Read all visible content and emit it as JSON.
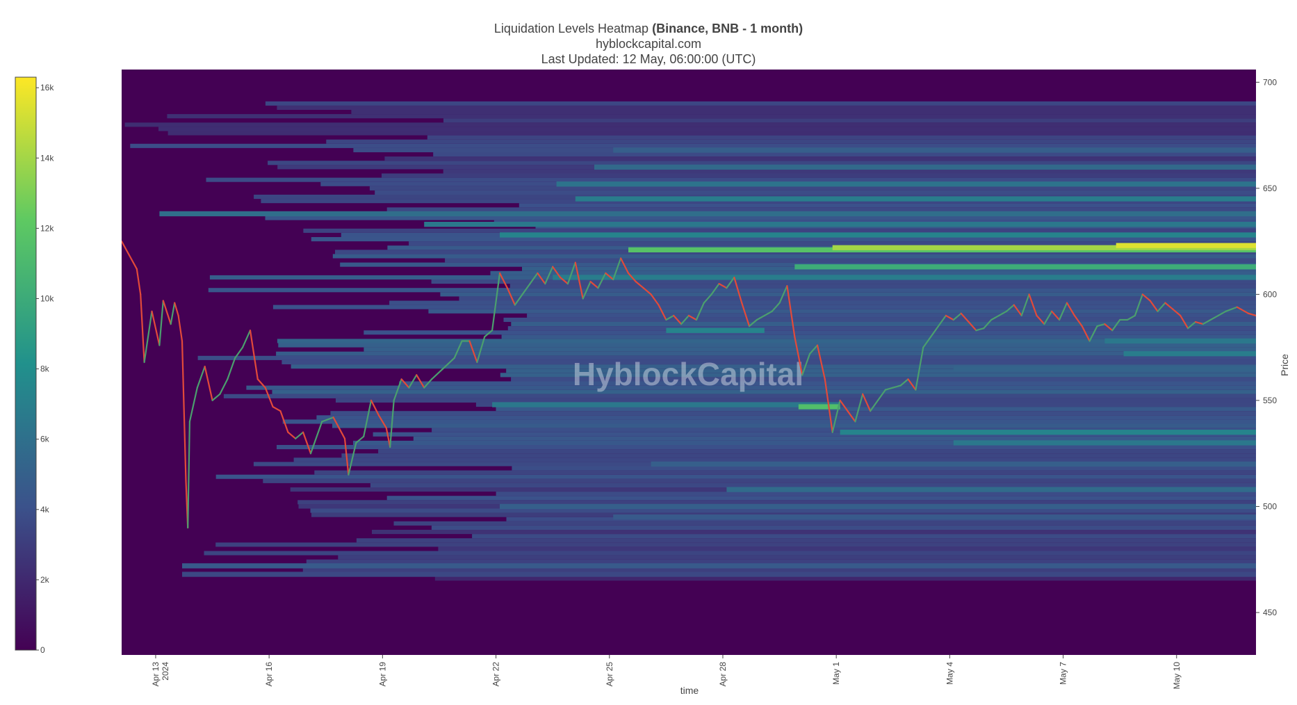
{
  "title": {
    "main": "Liquidation Levels Heatmap",
    "bold": "(Binance, BNB - 1 month)",
    "site": "hyblockcapital.com",
    "updated": "Last Updated: 12 May, 06:00:00 (UTC)"
  },
  "watermark": "HyblockCapital",
  "colors": {
    "background": "#440154",
    "candle_up": "#4b9f6e",
    "candle_down": "#e24a3a",
    "colorscale": [
      "#440154",
      "#3b528b",
      "#21918c",
      "#5ec962",
      "#fde725"
    ]
  },
  "chart_data": {
    "type": "heatmap",
    "xlabel": "time",
    "ylabel": "Price",
    "ylim": [
      430,
      706
    ],
    "x_ticks": [
      {
        "day": 0.9,
        "label": "Apr 13",
        "label2": "2024"
      },
      {
        "day": 3.9,
        "label": "Apr 16"
      },
      {
        "day": 6.9,
        "label": "Apr 19"
      },
      {
        "day": 9.9,
        "label": "Apr 22"
      },
      {
        "day": 12.9,
        "label": "Apr 25"
      },
      {
        "day": 15.9,
        "label": "Apr 28"
      },
      {
        "day": 18.9,
        "label": "May 1"
      },
      {
        "day": 21.9,
        "label": "May 4"
      },
      {
        "day": 24.9,
        "label": "May 7"
      },
      {
        "day": 27.9,
        "label": "May 10"
      }
    ],
    "x_domain_days": [
      0,
      30
    ],
    "y_ticks": [
      450,
      500,
      550,
      600,
      650,
      700
    ],
    "colorbar": {
      "ticks": [
        0,
        2000,
        4000,
        6000,
        8000,
        10000,
        12000,
        14000,
        16000
      ],
      "labels": [
        "0",
        "2k",
        "4k",
        "6k",
        "8k",
        "10k",
        "12k",
        "14k",
        "16k"
      ],
      "max": 16300
    },
    "price_path": [
      [
        0.0,
        625
      ],
      [
        0.4,
        612
      ],
      [
        0.5,
        600
      ],
      [
        0.6,
        568
      ],
      [
        0.8,
        592
      ],
      [
        1.0,
        576
      ],
      [
        1.1,
        597
      ],
      [
        1.3,
        586
      ],
      [
        1.4,
        596
      ],
      [
        1.5,
        590
      ],
      [
        1.6,
        578
      ],
      [
        1.7,
        512
      ],
      [
        1.75,
        490
      ],
      [
        1.8,
        540
      ],
      [
        2.0,
        556
      ],
      [
        2.2,
        566
      ],
      [
        2.4,
        550
      ],
      [
        2.6,
        553
      ],
      [
        2.8,
        560
      ],
      [
        3.0,
        570
      ],
      [
        3.2,
        575
      ],
      [
        3.4,
        583
      ],
      [
        3.6,
        560
      ],
      [
        3.8,
        556
      ],
      [
        4.0,
        547
      ],
      [
        4.2,
        545
      ],
      [
        4.4,
        535
      ],
      [
        4.6,
        532
      ],
      [
        4.8,
        535
      ],
      [
        5.0,
        525
      ],
      [
        5.3,
        540
      ],
      [
        5.6,
        542
      ],
      [
        5.9,
        532
      ],
      [
        6.0,
        515
      ],
      [
        6.2,
        530
      ],
      [
        6.4,
        533
      ],
      [
        6.6,
        550
      ],
      [
        6.8,
        543
      ],
      [
        7.0,
        537
      ],
      [
        7.1,
        528
      ],
      [
        7.2,
        550
      ],
      [
        7.4,
        560
      ],
      [
        7.6,
        556
      ],
      [
        7.8,
        562
      ],
      [
        8.0,
        556
      ],
      [
        8.2,
        560
      ],
      [
        8.5,
        565
      ],
      [
        8.8,
        570
      ],
      [
        9.0,
        578
      ],
      [
        9.2,
        578
      ],
      [
        9.4,
        568
      ],
      [
        9.6,
        580
      ],
      [
        9.8,
        583
      ],
      [
        10.0,
        610
      ],
      [
        10.2,
        603
      ],
      [
        10.4,
        595
      ],
      [
        10.6,
        600
      ],
      [
        10.8,
        605
      ],
      [
        11.0,
        610
      ],
      [
        11.2,
        605
      ],
      [
        11.4,
        613
      ],
      [
        11.6,
        608
      ],
      [
        11.8,
        605
      ],
      [
        12.0,
        615
      ],
      [
        12.2,
        598
      ],
      [
        12.4,
        606
      ],
      [
        12.6,
        603
      ],
      [
        12.8,
        610
      ],
      [
        13.0,
        607
      ],
      [
        13.2,
        617
      ],
      [
        13.4,
        610
      ],
      [
        13.6,
        606
      ],
      [
        13.8,
        603
      ],
      [
        14.0,
        600
      ],
      [
        14.2,
        595
      ],
      [
        14.4,
        588
      ],
      [
        14.6,
        590
      ],
      [
        14.8,
        586
      ],
      [
        15.0,
        590
      ],
      [
        15.2,
        588
      ],
      [
        15.4,
        596
      ],
      [
        15.6,
        600
      ],
      [
        15.8,
        605
      ],
      [
        16.0,
        603
      ],
      [
        16.2,
        608
      ],
      [
        16.4,
        596
      ],
      [
        16.6,
        585
      ],
      [
        16.8,
        588
      ],
      [
        17.0,
        590
      ],
      [
        17.2,
        592
      ],
      [
        17.4,
        596
      ],
      [
        17.6,
        604
      ],
      [
        17.8,
        580
      ],
      [
        18.0,
        562
      ],
      [
        18.2,
        572
      ],
      [
        18.4,
        576
      ],
      [
        18.6,
        560
      ],
      [
        18.8,
        535
      ],
      [
        19.0,
        550
      ],
      [
        19.2,
        545
      ],
      [
        19.4,
        540
      ],
      [
        19.6,
        553
      ],
      [
        19.8,
        545
      ],
      [
        20.0,
        550
      ],
      [
        20.2,
        555
      ],
      [
        20.4,
        556
      ],
      [
        20.6,
        557
      ],
      [
        20.8,
        560
      ],
      [
        21.0,
        555
      ],
      [
        21.2,
        575
      ],
      [
        21.4,
        580
      ],
      [
        21.6,
        585
      ],
      [
        21.8,
        590
      ],
      [
        22.0,
        588
      ],
      [
        22.2,
        591
      ],
      [
        22.4,
        587
      ],
      [
        22.6,
        583
      ],
      [
        22.8,
        584
      ],
      [
        23.0,
        588
      ],
      [
        23.2,
        590
      ],
      [
        23.4,
        592
      ],
      [
        23.6,
        595
      ],
      [
        23.8,
        590
      ],
      [
        24.0,
        600
      ],
      [
        24.2,
        590
      ],
      [
        24.4,
        586
      ],
      [
        24.6,
        592
      ],
      [
        24.8,
        588
      ],
      [
        25.0,
        596
      ],
      [
        25.2,
        590
      ],
      [
        25.4,
        585
      ],
      [
        25.6,
        578
      ],
      [
        25.8,
        585
      ],
      [
        26.0,
        586
      ],
      [
        26.2,
        583
      ],
      [
        26.4,
        588
      ],
      [
        26.6,
        588
      ],
      [
        26.8,
        590
      ],
      [
        27.0,
        600
      ],
      [
        27.2,
        597
      ],
      [
        27.4,
        592
      ],
      [
        27.6,
        596
      ],
      [
        27.8,
        593
      ],
      [
        28.0,
        590
      ],
      [
        28.2,
        584
      ],
      [
        28.4,
        587
      ],
      [
        28.6,
        586
      ],
      [
        28.8,
        588
      ],
      [
        29.0,
        590
      ],
      [
        29.2,
        592
      ],
      [
        29.5,
        594
      ],
      [
        29.8,
        591
      ],
      [
        30.0,
        590
      ]
    ],
    "bands": [
      {
        "price": 621,
        "day_start": 13.4,
        "day_end": 30,
        "intensity": 0.72
      },
      {
        "price": 622,
        "day_start": 18.8,
        "day_end": 30,
        "intensity": 0.86
      },
      {
        "price": 623,
        "day_start": 26.3,
        "day_end": 30,
        "intensity": 0.95
      },
      {
        "price": 613,
        "day_start": 17.8,
        "day_end": 30,
        "intensity": 0.62
      },
      {
        "price": 608,
        "day_start": 11.4,
        "day_end": 30,
        "intensity": 0.42
      },
      {
        "price": 628,
        "day_start": 10.0,
        "day_end": 30,
        "intensity": 0.45
      },
      {
        "price": 633,
        "day_start": 8.0,
        "day_end": 30,
        "intensity": 0.4
      },
      {
        "price": 638,
        "day_start": 1.0,
        "day_end": 30,
        "intensity": 0.36
      },
      {
        "price": 645,
        "day_start": 12.0,
        "day_end": 30,
        "intensity": 0.42
      },
      {
        "price": 652,
        "day_start": 11.5,
        "day_end": 30,
        "intensity": 0.38
      },
      {
        "price": 660,
        "day_start": 12.5,
        "day_end": 30,
        "intensity": 0.34
      },
      {
        "price": 668,
        "day_start": 13.0,
        "day_end": 30,
        "intensity": 0.3
      },
      {
        "price": 583,
        "day_start": 14.4,
        "day_end": 17.0,
        "intensity": 0.45
      },
      {
        "price": 578,
        "day_start": 26.0,
        "day_end": 30,
        "intensity": 0.4
      },
      {
        "price": 572,
        "day_start": 26.5,
        "day_end": 30,
        "intensity": 0.42
      },
      {
        "price": 565,
        "day_start": 22.0,
        "day_end": 30,
        "intensity": 0.32
      },
      {
        "price": 548,
        "day_start": 9.8,
        "day_end": 19.0,
        "intensity": 0.4
      },
      {
        "price": 547,
        "day_start": 17.9,
        "day_end": 19.0,
        "intensity": 0.7
      },
      {
        "price": 535,
        "day_start": 19.0,
        "day_end": 30,
        "intensity": 0.45
      },
      {
        "price": 530,
        "day_start": 22.0,
        "day_end": 30,
        "intensity": 0.4
      },
      {
        "price": 520,
        "day_start": 14.0,
        "day_end": 30,
        "intensity": 0.3
      },
      {
        "price": 508,
        "day_start": 16.0,
        "day_end": 30,
        "intensity": 0.35
      },
      {
        "price": 500,
        "day_start": 10.0,
        "day_end": 30,
        "intensity": 0.3
      },
      {
        "price": 495,
        "day_start": 13.0,
        "day_end": 30,
        "intensity": 0.28
      },
      {
        "price": 472,
        "day_start": 1.6,
        "day_end": 30,
        "intensity": 0.28
      },
      {
        "price": 468,
        "day_start": 1.6,
        "day_end": 30,
        "intensity": 0.22
      }
    ]
  }
}
